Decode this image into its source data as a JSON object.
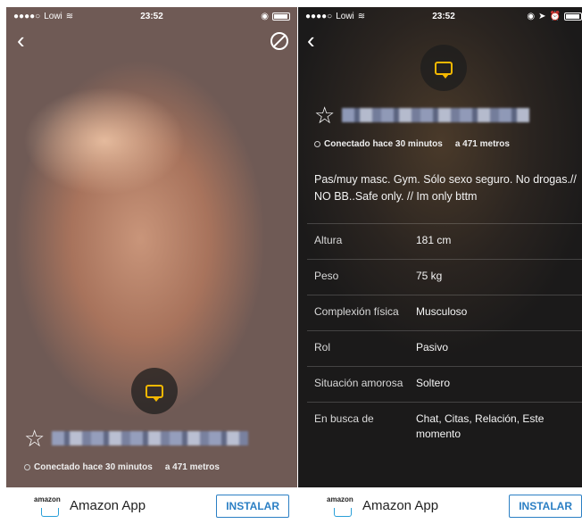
{
  "status_bar": {
    "carrier": "Lowi",
    "time": "23:52"
  },
  "profile": {
    "online_status": "Conectado hace 30 minutos",
    "distance": "a 471 metros",
    "bio": "Pas/muy masc.  Gym. Sólo sexo seguro. No drogas.// NO BB..Safe only. // Im only  bttm",
    "attributes": [
      {
        "label": "Altura",
        "value": "181 cm"
      },
      {
        "label": "Peso",
        "value": "75 kg"
      },
      {
        "label": "Complexión física",
        "value": "Musculoso"
      },
      {
        "label": "Rol",
        "value": "Pasivo"
      },
      {
        "label": "Situación amorosa",
        "value": "Soltero"
      },
      {
        "label": "En busca de",
        "value": "Chat, Citas, Relación, Este momento"
      }
    ]
  },
  "ad": {
    "logo_text": "amazon",
    "app_name": "Amazon App",
    "install_label": "INSTALAR"
  },
  "colors": {
    "accent_chat": "#f5b800",
    "install_blue": "#2b7fc4"
  },
  "icons": {
    "back": "chevron-left-icon",
    "block": "block-icon",
    "chat": "chat-bubble-icon",
    "favorite": "star-outline-icon"
  }
}
